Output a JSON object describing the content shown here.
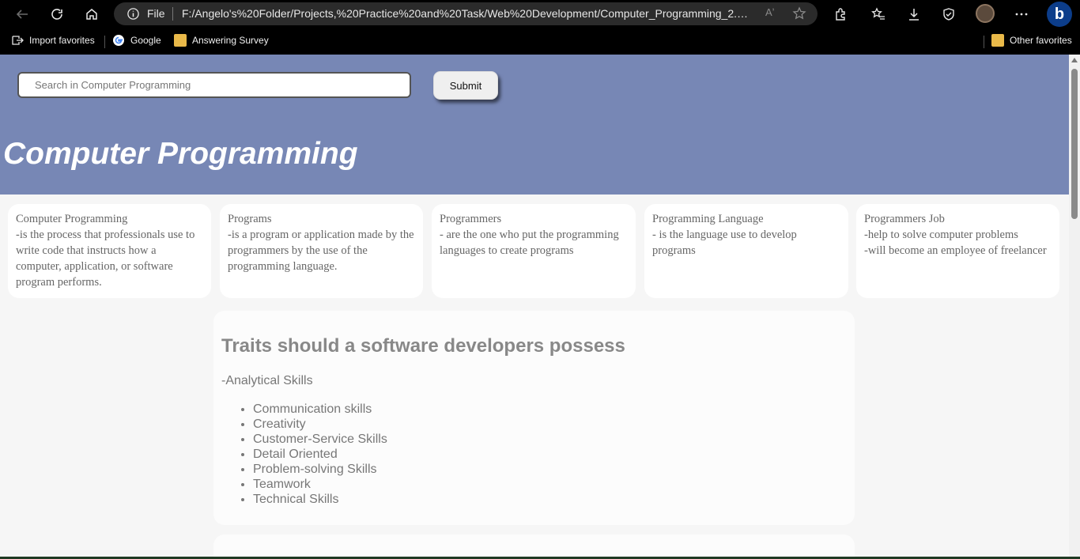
{
  "browser": {
    "address_scheme": "File",
    "url": "F:/Angelo's%20Folder/Projects,%20Practice%20and%20Task/Web%20Development/Computer_Programming_2.0/Co...",
    "read_aloud_label": "Aʼ",
    "bing_label": "b",
    "favorites": [
      {
        "label": "Import favorites",
        "icon": "import-icon"
      },
      {
        "label": "Google",
        "icon": "google-icon"
      },
      {
        "label": "Answering Survey",
        "icon": "folder-icon"
      }
    ],
    "other_favorites": "Other favorites"
  },
  "search": {
    "placeholder": "Search in Computer Programming",
    "submit_label": "Submit"
  },
  "hero": {
    "title": "Computer Programming",
    "background": "#7787b5"
  },
  "cards": [
    {
      "title": "Computer Programming",
      "lines": [
        "-is the process that professionals use to write code that instructs how a computer, application, or software program performs."
      ]
    },
    {
      "title": "Programs",
      "lines": [
        "-is a program or application made by the programmers by the use of the programming language."
      ]
    },
    {
      "title": "Programmers",
      "lines": [
        "- are the one who put the programming languages to create programs"
      ]
    },
    {
      "title": "Programming Language",
      "lines": [
        "- is the language use to develop programs"
      ]
    },
    {
      "title": "Programmers Job",
      "lines": [
        "-help to solve computer problems",
        "-will become an employee of freelancer"
      ]
    }
  ],
  "traits": {
    "heading": "Traits should a software developers possess",
    "lead": "-Analytical Skills",
    "items": [
      "Communication skills",
      "Creativity",
      "Customer-Service Skills",
      "Detail Oriented",
      "Problem-solving Skills",
      "Teamwork",
      "Technical Skills"
    ]
  }
}
